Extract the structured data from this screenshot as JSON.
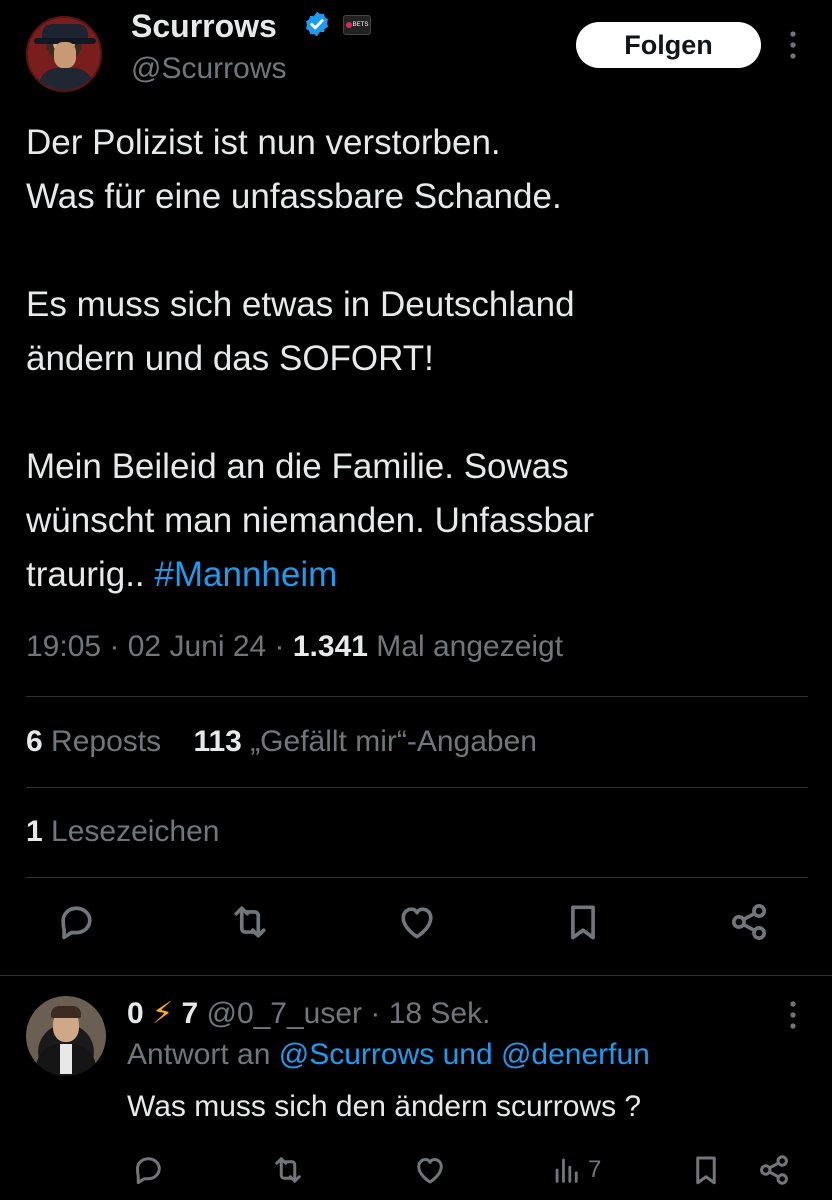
{
  "author": {
    "display_name": "Scurrows",
    "handle": "@Scurrows",
    "badge_text": "BETS"
  },
  "follow_label": "Folgen",
  "tweet": {
    "body": "Der Polizist ist nun verstorben.\nWas für eine unfassbare Schande.\n\nEs muss sich etwas in Deutschland\nändern und das SOFORT!\n\nMein Beileid an die Familie. Sowas\nwünscht man niemanden. Unfassbar\ntraurig.. ",
    "hashtag": "#Mannheim",
    "time": "19:05",
    "date": "02 Juni 24",
    "views_count": "1.341",
    "views_label": "Mal angezeigt"
  },
  "stats": {
    "reposts_count": "6",
    "reposts_label": "Reposts",
    "likes_count": "113",
    "likes_label": "„Gefällt mir“-Angaben",
    "bookmarks_count": "1",
    "bookmarks_label": "Lesezeichen"
  },
  "reply": {
    "name_part1": "0",
    "name_bolt": "⚡",
    "name_part2": "7",
    "handle": "@0_7_user",
    "time": "18 Sek.",
    "replying_prefix": "Antwort an",
    "replying_mentions": "@Scurrows und @denerfun",
    "text": "Was muss sich den ändern scurrows ?",
    "views": "7"
  },
  "icons": {
    "verified": "verified-badge-icon",
    "more": "more-vertical-icon",
    "reply": "reply-icon",
    "repost": "repost-icon",
    "like": "heart-icon",
    "bookmark": "bookmark-icon",
    "share": "share-icon",
    "views": "analytics-icon"
  },
  "colors": {
    "background": "#000000",
    "text": "#e7e9ea",
    "muted": "#71767b",
    "accent": "#1d9bf0",
    "divider": "#2f3336"
  }
}
